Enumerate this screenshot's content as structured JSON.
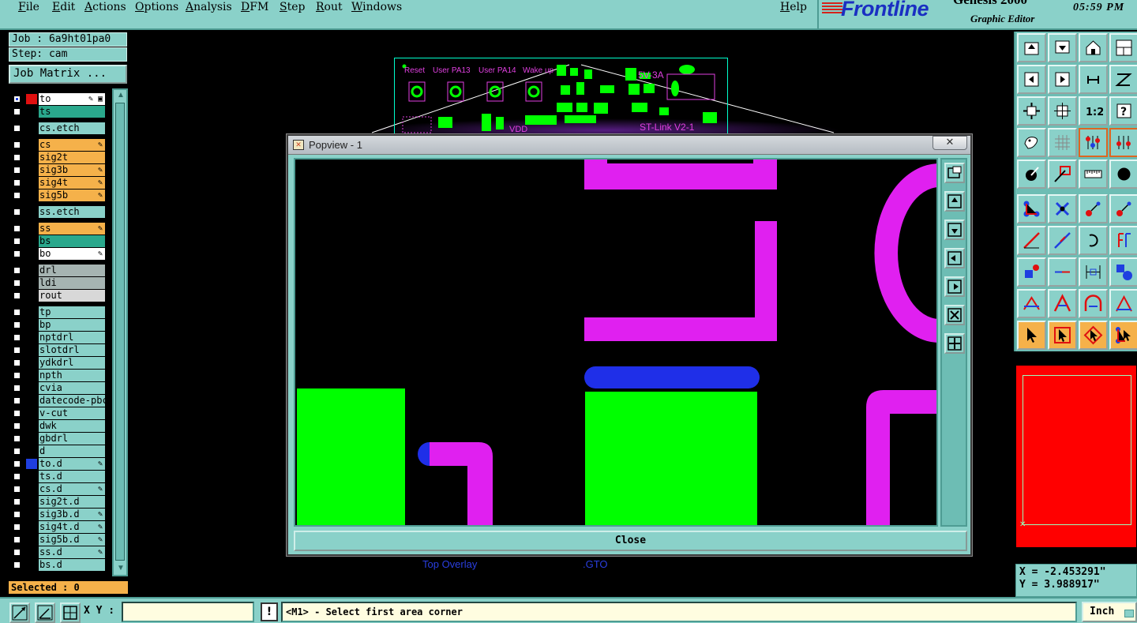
{
  "menu": [
    "File",
    "Edit",
    "Actions",
    "Options",
    "Analysis",
    "DFM",
    "Step",
    "Rout",
    "Windows"
  ],
  "help_label": "Help",
  "brand": {
    "logo": "Frontline",
    "product": "Genesis 2000",
    "subtitle": "Graphic Editor",
    "clock": "05:59 PM"
  },
  "job_info": {
    "job": "Job : 6a9ht01pa0",
    "step": "Step: cam",
    "job_matrix_label": "Job Matrix ..."
  },
  "layers": [
    {
      "name": "to",
      "bg": "#ffffff",
      "swatch": "#e01010",
      "checked": true,
      "flag": "✎ ▣"
    },
    {
      "name": "ts",
      "bg": "#2aa88c",
      "swatch": "",
      "checked": false,
      "flag": ""
    },
    {
      "name": "cs.etch",
      "bg": "#8ad1c9",
      "swatch": "",
      "checked": false,
      "flag": ""
    },
    {
      "name": "cs",
      "bg": "#f5b14a",
      "swatch": "",
      "checked": false,
      "flag": "✎"
    },
    {
      "name": "sig2t",
      "bg": "#f5b14a",
      "swatch": "",
      "checked": false,
      "flag": ""
    },
    {
      "name": "sig3b",
      "bg": "#f5b14a",
      "swatch": "",
      "checked": false,
      "flag": "✎"
    },
    {
      "name": "sig4t",
      "bg": "#f5b14a",
      "swatch": "",
      "checked": false,
      "flag": "✎"
    },
    {
      "name": "sig5b",
      "bg": "#f5b14a",
      "swatch": "",
      "checked": false,
      "flag": "✎"
    },
    {
      "name": "ss.etch",
      "bg": "#8ad1c9",
      "swatch": "",
      "checked": false,
      "flag": ""
    },
    {
      "name": "ss",
      "bg": "#f5b14a",
      "swatch": "",
      "checked": false,
      "flag": "✎"
    },
    {
      "name": "bs",
      "bg": "#2aa88c",
      "swatch": "",
      "checked": false,
      "flag": ""
    },
    {
      "name": "bo",
      "bg": "#ffffff",
      "swatch": "",
      "checked": false,
      "flag": "✎"
    },
    {
      "name": "drl",
      "bg": "#a6b4b2",
      "swatch": "",
      "checked": false,
      "flag": ""
    },
    {
      "name": "ldi",
      "bg": "#a6b4b2",
      "swatch": "",
      "checked": false,
      "flag": ""
    },
    {
      "name": "rout",
      "bg": "#d8d8d8",
      "swatch": "",
      "checked": false,
      "flag": ""
    },
    {
      "name": "tp",
      "bg": "#8ad1c9",
      "swatch": "",
      "checked": false,
      "flag": ""
    },
    {
      "name": "bp",
      "bg": "#8ad1c9",
      "swatch": "",
      "checked": false,
      "flag": ""
    },
    {
      "name": "nptdrl",
      "bg": "#8ad1c9",
      "swatch": "",
      "checked": false,
      "flag": ""
    },
    {
      "name": "slotdrl",
      "bg": "#8ad1c9",
      "swatch": "",
      "checked": false,
      "flag": ""
    },
    {
      "name": "ydkdrl",
      "bg": "#8ad1c9",
      "swatch": "",
      "checked": false,
      "flag": ""
    },
    {
      "name": "npth",
      "bg": "#8ad1c9",
      "swatch": "",
      "checked": false,
      "flag": ""
    },
    {
      "name": "cvia",
      "bg": "#8ad1c9",
      "swatch": "",
      "checked": false,
      "flag": ""
    },
    {
      "name": "datecode-pbc",
      "bg": "#8ad1c9",
      "swatch": "",
      "checked": false,
      "flag": ""
    },
    {
      "name": "v-cut",
      "bg": "#8ad1c9",
      "swatch": "",
      "checked": false,
      "flag": ""
    },
    {
      "name": "dwk",
      "bg": "#8ad1c9",
      "swatch": "",
      "checked": false,
      "flag": ""
    },
    {
      "name": "gbdrl",
      "bg": "#8ad1c9",
      "swatch": "",
      "checked": false,
      "flag": ""
    },
    {
      "name": "d",
      "bg": "#8ad1c9",
      "swatch": "",
      "checked": false,
      "flag": ""
    },
    {
      "name": "to.d",
      "bg": "#8ad1c9",
      "swatch": "#1f3fe0",
      "checked": false,
      "flag": "✎"
    },
    {
      "name": "ts.d",
      "bg": "#8ad1c9",
      "swatch": "",
      "checked": false,
      "flag": ""
    },
    {
      "name": "cs.d",
      "bg": "#8ad1c9",
      "swatch": "",
      "checked": false,
      "flag": "✎"
    },
    {
      "name": "sig2t.d",
      "bg": "#8ad1c9",
      "swatch": "",
      "checked": false,
      "flag": ""
    },
    {
      "name": "sig3b.d",
      "bg": "#8ad1c9",
      "swatch": "",
      "checked": false,
      "flag": "✎"
    },
    {
      "name": "sig4t.d",
      "bg": "#8ad1c9",
      "swatch": "",
      "checked": false,
      "flag": "✎"
    },
    {
      "name": "sig5b.d",
      "bg": "#8ad1c9",
      "swatch": "",
      "checked": false,
      "flag": "✎"
    },
    {
      "name": "ss.d",
      "bg": "#8ad1c9",
      "swatch": "",
      "checked": false,
      "flag": "✎"
    },
    {
      "name": "bs.d",
      "bg": "#8ad1c9",
      "swatch": "",
      "checked": false,
      "flag": ""
    }
  ],
  "selected_label": "Selected : 0",
  "board_labels": [
    "Reset",
    "User PA13",
    "User PA14",
    "Wake up",
    "5V-3A",
    "VDD",
    "ST-Link V2-1"
  ],
  "canvas_labels": [
    "Top Overlay",
    ".GTO"
  ],
  "popview": {
    "title": "Popview - 1",
    "close_x": "✕",
    "close_button": "Close",
    "tools": [
      "zoom-window-icon",
      "zoom-up-icon",
      "zoom-down-icon",
      "pan-left-icon",
      "pan-right-icon",
      "zoom-fit-icon",
      "center-icon"
    ]
  },
  "toolbox": {
    "rows": [
      [
        "page-up-icon",
        "page-down-icon",
        "home-icon",
        "split-window-icon"
      ],
      [
        "arrow-left-icon",
        "arrow-right-icon",
        "undo-redo-icon",
        "flip-icon"
      ],
      [
        "zoom-extents-icon",
        "center-view-icon",
        "scale-1-2-icon",
        "help-query-icon"
      ],
      [
        "palette-icon",
        "grid-icon",
        "snap-red-icon",
        "snap-red-alt-icon"
      ],
      [
        "select-feature-icon",
        "highlight-box-icon",
        "ruler-icon",
        "pad-icon"
      ],
      [
        "connect-nodes-icon",
        "cross-icon",
        "move-pad-icon",
        "move-pad-alt-icon"
      ],
      [
        "line-tool-icon",
        "line-tool-alt-icon",
        "arc-tool-icon",
        "mirror-icon"
      ],
      [
        "pad-add-icon",
        "segment-icon",
        "dimension-icon",
        "shapes-icon"
      ],
      [
        "triangle-icon",
        "triangle-bold-icon",
        "arch-icon",
        "arch-alt-icon"
      ],
      [
        "pointer-icon",
        "pointer-box-icon",
        "pointer-diamond-icon",
        "pointer-network-icon"
      ]
    ]
  },
  "coords": {
    "x": "X = -2.453291\"",
    "y": "Y = 3.988917\""
  },
  "bottom": {
    "xy_label": "X Y :",
    "xy_value": "",
    "msg_icon": "!",
    "status": "<M1> - Select first area corner",
    "units": "Inch"
  },
  "colors": {
    "panel": "#8ad1c9",
    "accent_orange": "#f5b14a",
    "copper_green": "#00ff00",
    "overlay_magenta": "#e020f0",
    "solder_blue": "#1f3fe0"
  }
}
